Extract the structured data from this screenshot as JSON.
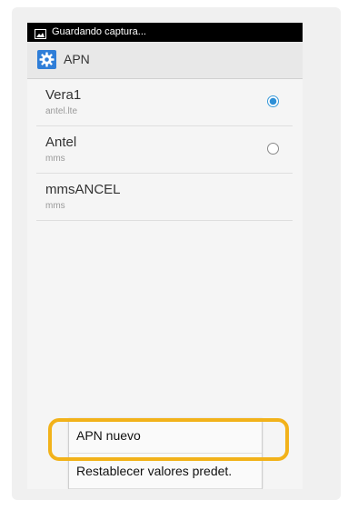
{
  "statusbar": {
    "text": "Guardando captura..."
  },
  "actionbar": {
    "title": "APN",
    "icon": "gear-icon",
    "accent": "#2f7ed8"
  },
  "apns": [
    {
      "name": "Vera1",
      "type": "antel.lte",
      "selected": true
    },
    {
      "name": "Antel",
      "type": "mms",
      "selected": false
    },
    {
      "name": "mmsANCEL",
      "type": "mms",
      "selected": null
    }
  ],
  "menu": {
    "items": [
      {
        "label": "APN nuevo"
      },
      {
        "label": "Restablecer valores predet."
      }
    ]
  },
  "colors": {
    "highlight": "#f2b21a",
    "radio_selected": "#2e8fd6"
  }
}
